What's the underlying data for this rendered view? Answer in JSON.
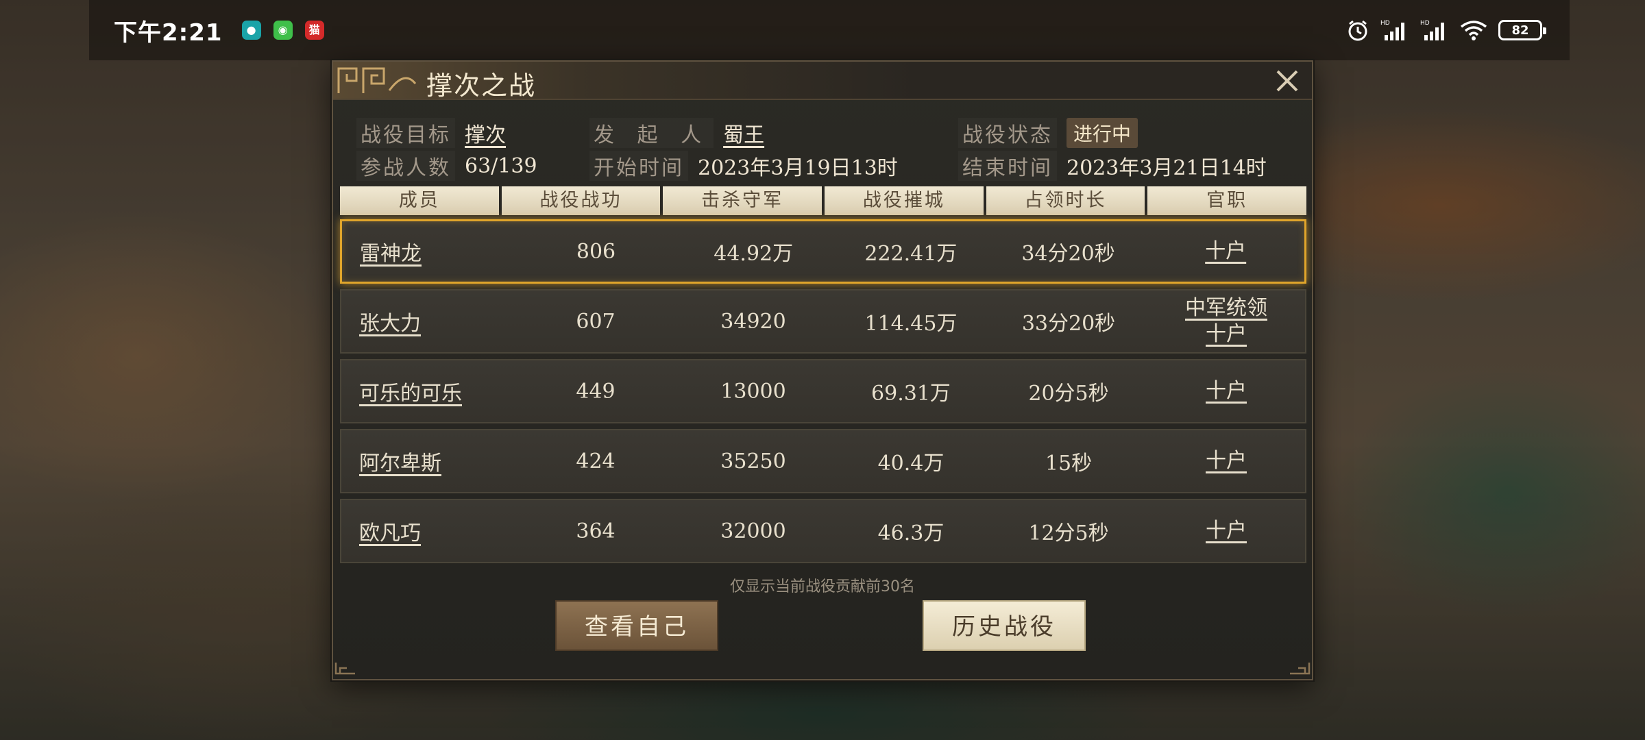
{
  "status_bar": {
    "time": "下午2:21",
    "battery": "82",
    "app_icon_text": "猫"
  },
  "dialog": {
    "title": "撑次之战",
    "info": {
      "target_label": "战役目标",
      "target_value": "撑次",
      "initiator_label": "发 起 人",
      "initiator_value": "蜀王",
      "status_label": "战役状态",
      "status_value": "进行中",
      "participants_label": "参战人数",
      "participants_value": "63/139",
      "start_label": "开始时间",
      "start_value": "2023年3月19日13时",
      "end_label": "结束时间",
      "end_value": "2023年3月21日14时"
    },
    "columns": [
      "成员",
      "战役战功",
      "击杀守军",
      "战役摧城",
      "占领时长",
      "官职"
    ],
    "rows": [
      {
        "name": "雷神龙",
        "merit": "806",
        "kills": "44.92万",
        "siege": "222.41万",
        "duration": "34分20秒",
        "title1": "十户",
        "title2": ""
      },
      {
        "name": "张大力",
        "merit": "607",
        "kills": "34920",
        "siege": "114.45万",
        "duration": "33分20秒",
        "title1": "中军统领",
        "title2": "十户"
      },
      {
        "name": "可乐的可乐",
        "merit": "449",
        "kills": "13000",
        "siege": "69.31万",
        "duration": "20分5秒",
        "title1": "十户",
        "title2": ""
      },
      {
        "name": "阿尔卑斯",
        "merit": "424",
        "kills": "35250",
        "siege": "40.4万",
        "duration": "15秒",
        "title1": "十户",
        "title2": ""
      },
      {
        "name": "欧凡巧",
        "merit": "364",
        "kills": "32000",
        "siege": "46.3万",
        "duration": "12分5秒",
        "title1": "十户",
        "title2": ""
      }
    ],
    "footnote": "仅显示当前战役贡献前30名",
    "view_self_label": "查看自己",
    "history_label": "历史战役"
  }
}
